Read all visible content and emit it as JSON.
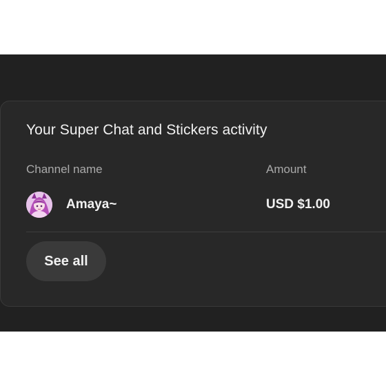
{
  "card": {
    "title": "Your Super Chat and Stickers activity",
    "columns": {
      "channel": "Channel name",
      "amount": "Amount"
    },
    "rows": [
      {
        "avatar": "anime-avatar-image",
        "channel_name": "Amaya~",
        "amount": "USD $1.00"
      }
    ],
    "see_all_label": "See all"
  },
  "colors": {
    "panel_background": "#212121",
    "card_background": "#282828",
    "button_background": "#3a3a3a",
    "primary_text": "#f1f1f1",
    "secondary_text": "#aaaaaa"
  }
}
